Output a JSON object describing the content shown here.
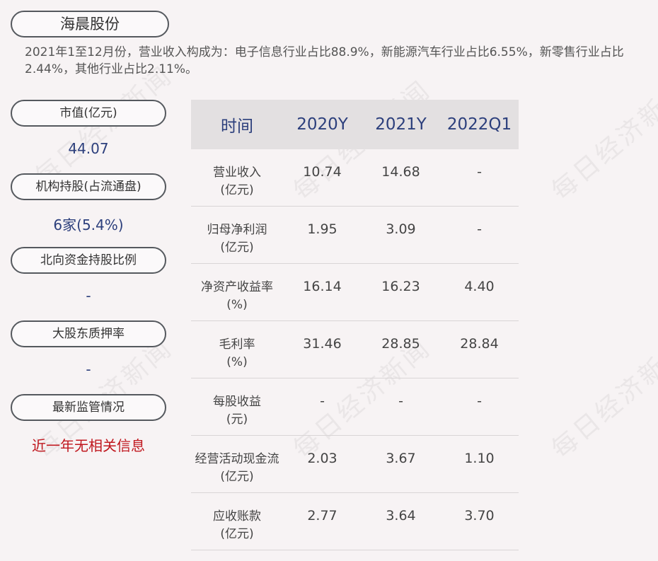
{
  "company": "海晨股份",
  "summary": "2021年1至12月份，营业收入构成为：电子信息行业占比88.9%，新能源汽车行业占比6.55%，新零售行业占比2.44%，其他行业占比2.11%。",
  "sidebar": [
    {
      "label": "市值(亿元)",
      "value": "44.07"
    },
    {
      "label": "机构持股(占流通盘)",
      "value": "6家(5.4%)"
    },
    {
      "label": "北向资金持股比例",
      "value": "-"
    },
    {
      "label": "大股东质押率",
      "value": "-"
    },
    {
      "label": "最新监管情况",
      "value": "近一年无相关信息"
    }
  ],
  "table": {
    "headers": [
      "时间",
      "2020Y",
      "2021Y",
      "2022Q1"
    ],
    "rows": [
      {
        "name": "营业收入",
        "unit": "(亿元)",
        "values": [
          "10.74",
          "14.68",
          "-"
        ]
      },
      {
        "name": "归母净利润",
        "unit": "(亿元)",
        "values": [
          "1.95",
          "3.09",
          "-"
        ]
      },
      {
        "name": "净资产收益率",
        "unit": "(%)",
        "values": [
          "16.14",
          "16.23",
          "4.40"
        ]
      },
      {
        "name": "毛利率",
        "unit": "(%)",
        "values": [
          "31.46",
          "28.85",
          "28.84"
        ]
      },
      {
        "name": "每股收益",
        "unit": "(元)",
        "values": [
          "-",
          "-",
          "-"
        ]
      },
      {
        "name": "经营活动现金流",
        "unit": "(亿元)",
        "values": [
          "2.03",
          "3.67",
          "1.10"
        ]
      },
      {
        "name": "应收账款",
        "unit": "(亿元)",
        "values": [
          "2.77",
          "3.64",
          "3.70"
        ]
      }
    ]
  },
  "watermark": "每日经济新闻"
}
